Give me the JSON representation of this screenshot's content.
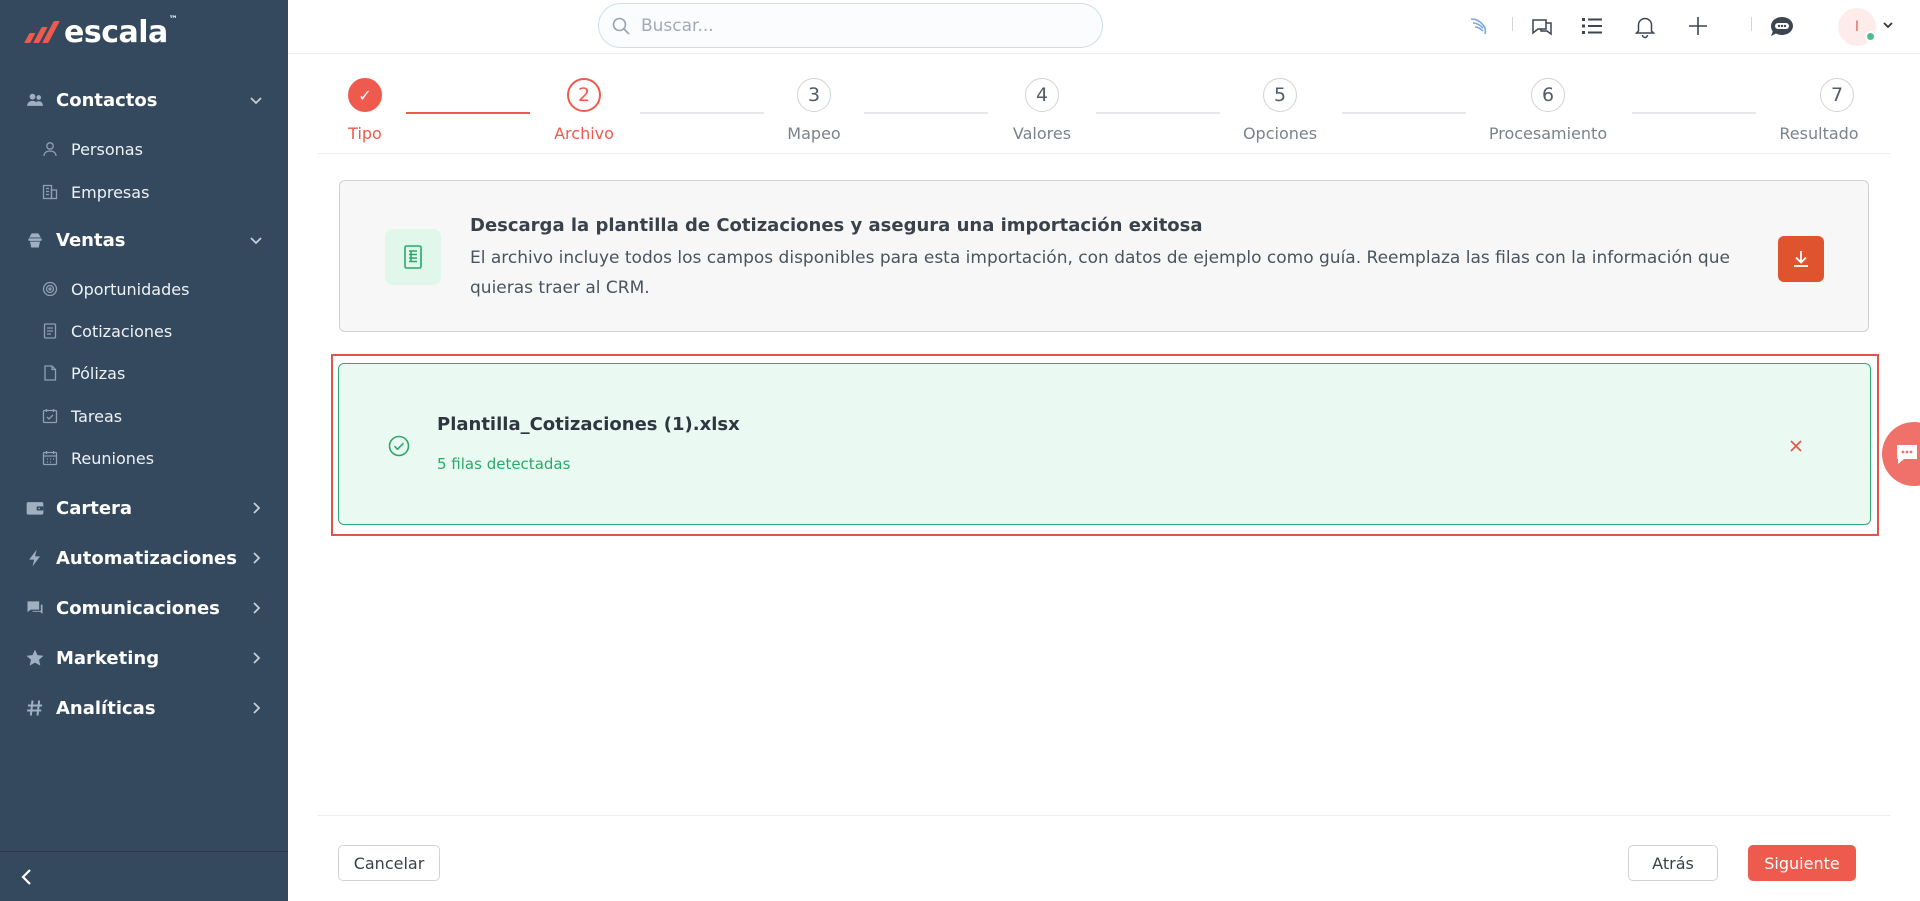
{
  "brand": {
    "name": "escala",
    "tm": "™"
  },
  "sidebar": {
    "sections": [
      {
        "label": "Contactos",
        "icon": "users-icon",
        "expanded": true
      },
      {
        "label": "Ventas",
        "icon": "ventas-icon",
        "expanded": true
      },
      {
        "label": "Cartera",
        "icon": "wallet-icon",
        "expanded": false
      },
      {
        "label": "Automatizaciones",
        "icon": "bolt-icon",
        "expanded": false
      },
      {
        "label": "Comunicaciones",
        "icon": "chat-icon",
        "expanded": false
      },
      {
        "label": "Marketing",
        "icon": "star-icon",
        "expanded": false
      },
      {
        "label": "Analíticas",
        "icon": "hash-icon",
        "expanded": false
      }
    ],
    "contactos_items": [
      {
        "label": "Personas",
        "icon": "person-icon"
      },
      {
        "label": "Empresas",
        "icon": "building-icon"
      }
    ],
    "ventas_items": [
      {
        "label": "Oportunidades",
        "icon": "target-icon"
      },
      {
        "label": "Cotizaciones",
        "icon": "document-icon"
      },
      {
        "label": "Pólizas",
        "icon": "file-icon"
      },
      {
        "label": "Tareas",
        "icon": "calendar-check-icon"
      },
      {
        "label": "Reuniones",
        "icon": "calendar-icon"
      }
    ]
  },
  "topbar": {
    "search_placeholder": "Buscar...",
    "avatar_initial": "I"
  },
  "stepper": {
    "steps": [
      {
        "number": "✓",
        "label": "Tipo",
        "state": "done"
      },
      {
        "number": "2",
        "label": "Archivo",
        "state": "active"
      },
      {
        "number": "3",
        "label": "Mapeo",
        "state": "pending"
      },
      {
        "number": "4",
        "label": "Valores",
        "state": "pending"
      },
      {
        "number": "5",
        "label": "Opciones",
        "state": "pending"
      },
      {
        "number": "6",
        "label": "Procesamiento",
        "state": "pending"
      },
      {
        "number": "7",
        "label": "Resultado",
        "state": "pending"
      }
    ]
  },
  "template": {
    "title": "Descarga la plantilla de Cotizaciones y asegura una importación exitosa",
    "description": "El archivo incluye todos los campos disponibles para esta importación, con datos de ejemplo como guía. Reemplaza las filas con la información que quieras traer al CRM."
  },
  "upload": {
    "file_name": "Plantilla_Cotizaciones (1).xlsx",
    "rows_detected": "5 filas detectadas"
  },
  "footer": {
    "cancel_label": "Cancelar",
    "back_label": "Atrás",
    "next_label": "Siguiente"
  },
  "colors": {
    "accent": "#ef5a4e",
    "sidebar_bg": "#34495e",
    "success": "#2aa86a",
    "download_btn": "#e0532f"
  }
}
